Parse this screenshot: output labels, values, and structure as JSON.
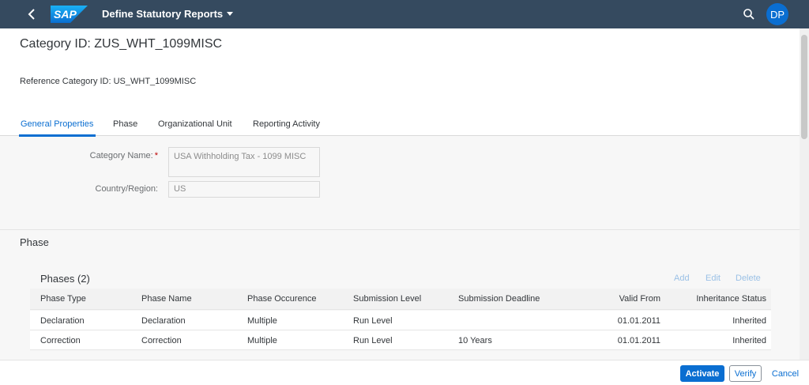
{
  "shell": {
    "logo_text": "SAP",
    "app_title": "Define Statutory Reports",
    "avatar_initials": "DP"
  },
  "header": {
    "title": "Category ID: ZUS_WHT_1099MISC",
    "reference": "Reference Category ID: US_WHT_1099MISC"
  },
  "tabs": [
    {
      "label": "General Properties"
    },
    {
      "label": "Phase"
    },
    {
      "label": "Organizational Unit"
    },
    {
      "label": "Reporting Activity"
    }
  ],
  "general": {
    "category_name_label": "Category Name:",
    "required_mark": "*",
    "category_name_value": "USA Withholding Tax - 1099 MISC",
    "country_label": "Country/Region:",
    "country_value": "US"
  },
  "phase_section": {
    "title": "Phase",
    "table_title": "Phases (2)",
    "actions": {
      "add": "Add",
      "edit": "Edit",
      "delete": "Delete"
    },
    "columns": [
      "Phase Type",
      "Phase Name",
      "Phase Occurence",
      "Submission Level",
      "Submission Deadline",
      "Valid From",
      "Inheritance Status"
    ],
    "rows": [
      [
        "Declaration",
        "Declaration",
        "Multiple",
        "Run Level",
        "",
        "01.01.2011",
        "Inherited"
      ],
      [
        "Correction",
        "Correction",
        "Multiple",
        "Run Level",
        "10 Years",
        "01.01.2011",
        "Inherited"
      ]
    ]
  },
  "footer": {
    "activate": "Activate",
    "verify": "Verify",
    "cancel": "Cancel"
  },
  "colors": {
    "shell": "#354a5f",
    "accent": "#0a6ed1",
    "required": "#bb0000"
  },
  "icons": {
    "back": "chevron-left-icon",
    "search": "search-icon",
    "dropdown": "caret-down-icon"
  }
}
